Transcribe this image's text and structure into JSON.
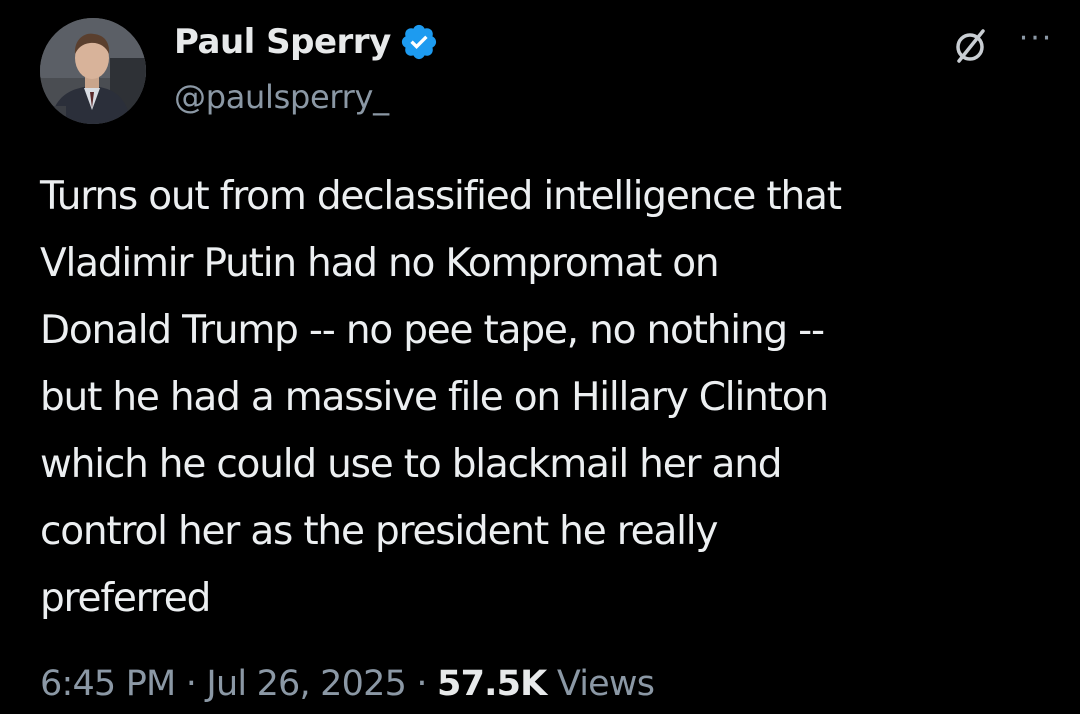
{
  "author": {
    "display_name": "Paul Sperry",
    "handle": "@paulsperry_",
    "verified": true,
    "avatar_icon": "profile-photo",
    "verified_color": "#1d9bf0"
  },
  "actions": {
    "grok_icon": "grok-slash-circle-icon",
    "more_icon": "more-horizontal-icon",
    "more_label": "···"
  },
  "tweet": {
    "lines": [
      "Turns out from declassified intelligence that",
      "Vladimir Putin had no Kompromat on",
      "Donald Trump -- no pee tape, no nothing --",
      "but he had a massive file on Hillary Clinton",
      "which he could use to blackmail her and",
      "control her as the president he really",
      "preferred"
    ]
  },
  "meta": {
    "time": "6:45 PM",
    "separator": "·",
    "date": "Jul 26, 2025",
    "views_count": "57.5K",
    "views_label": "Views"
  },
  "colors": {
    "background": "#000000",
    "primary_text": "#e7e9ea",
    "secondary_text": "#8b98a5"
  }
}
